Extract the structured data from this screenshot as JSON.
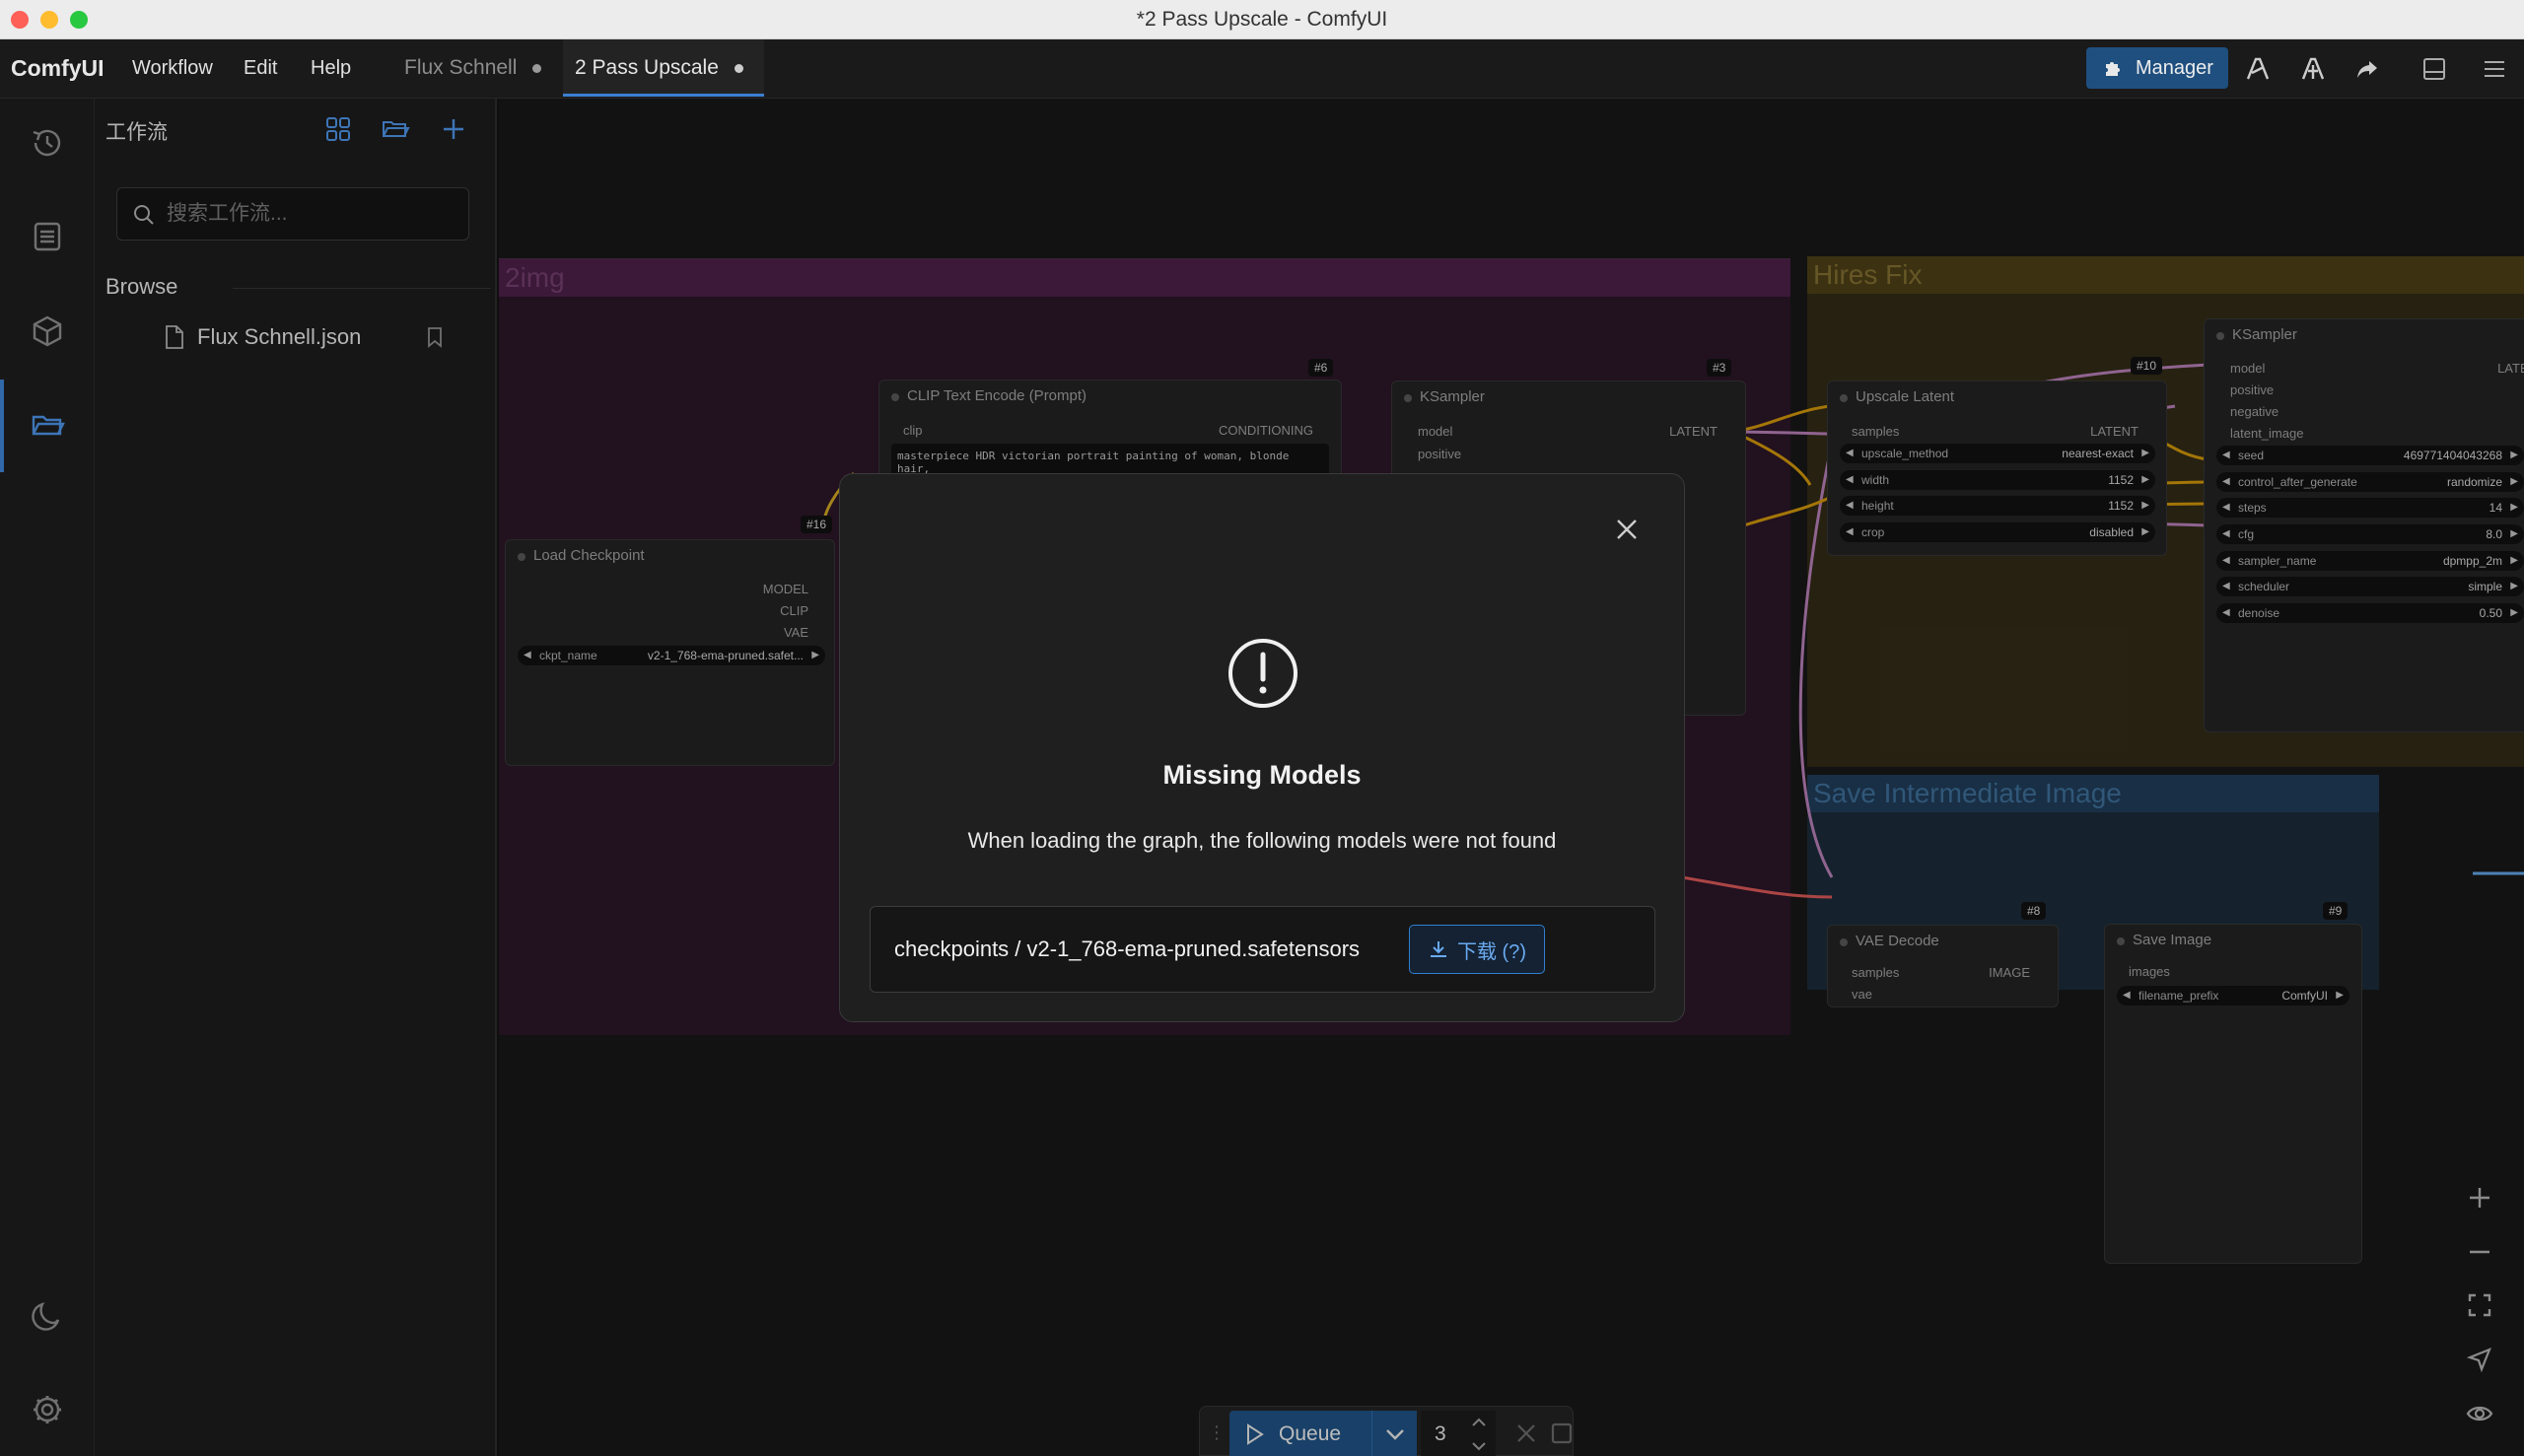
{
  "window": {
    "title": "*2 Pass Upscale - ComfyUI"
  },
  "menubar": {
    "brand": "ComfyUI",
    "menus": [
      "Workflow",
      "Edit",
      "Help"
    ],
    "tabs": [
      {
        "label": "Flux Schnell"
      },
      {
        "label": "2 Pass Upscale"
      }
    ],
    "manager_label": "Manager"
  },
  "sidebar": {
    "title": "工作流",
    "search_placeholder": "搜索工作流...",
    "section": "Browse",
    "files": [
      "Flux Schnell.json"
    ]
  },
  "canvas": {
    "groups": {
      "txt2img": "2img",
      "hires": "Hires Fix",
      "save_intermediate": "Save Intermediate Image"
    },
    "nodes": {
      "clip_text": {
        "id": "#6",
        "title": "CLIP Text Encode (Prompt)",
        "in": "clip",
        "out": "CONDITIONING",
        "text": "masterpiece HDR victorian portrait painting of woman, blonde hair,"
      },
      "ksampler1": {
        "id": "#3",
        "title": "KSampler",
        "out": "LATENT",
        "inputs": [
          "model",
          "positive"
        ]
      },
      "load_ckpt": {
        "id": "#16",
        "title": "Load Checkpoint",
        "outs": [
          "MODEL",
          "CLIP",
          "VAE"
        ],
        "widget_name": "ckpt_name",
        "widget_value": "v2-1_768-ema-pruned.safet..."
      },
      "upscale": {
        "id": "#10",
        "title": "Upscale Latent",
        "in": "samples",
        "out": "LATENT",
        "widgets": [
          {
            "name": "upscale_method",
            "value": "nearest-exact"
          },
          {
            "name": "width",
            "value": "1152"
          },
          {
            "name": "height",
            "value": "1152"
          },
          {
            "name": "crop",
            "value": "disabled"
          }
        ]
      },
      "ksampler2": {
        "title": "KSampler",
        "inputs": [
          "model",
          "positive",
          "negative",
          "latent_image"
        ],
        "out": "LATEN",
        "widgets": [
          {
            "name": "seed",
            "value": "469771404043268"
          },
          {
            "name": "control_after_generate",
            "value": "randomize"
          },
          {
            "name": "steps",
            "value": "14"
          },
          {
            "name": "cfg",
            "value": "8.0"
          },
          {
            "name": "sampler_name",
            "value": "dpmpp_2m"
          },
          {
            "name": "scheduler",
            "value": "simple"
          },
          {
            "name": "denoise",
            "value": "0.50"
          }
        ]
      },
      "vae_decode": {
        "id": "#8",
        "title": "VAE Decode",
        "inputs": [
          "samples",
          "vae"
        ],
        "out": "IMAGE"
      },
      "save_image": {
        "id": "#9",
        "title": "Save Image",
        "in": "images",
        "widget_name": "filename_prefix",
        "widget_value": "ComfyUI"
      }
    }
  },
  "dialog": {
    "title": "Missing Models",
    "message": "When loading the graph, the following models were not found",
    "model_path": "checkpoints / v2-1_768-ema-pruned.safetensors",
    "download_label": "下载 (?)"
  },
  "queue": {
    "label": "Queue",
    "count": "3"
  },
  "colors": {
    "accent": "#1f6fb8",
    "txt2img_group": "#3a1a38",
    "hires_group": "#3d3416",
    "save_group": "#1d3347"
  }
}
